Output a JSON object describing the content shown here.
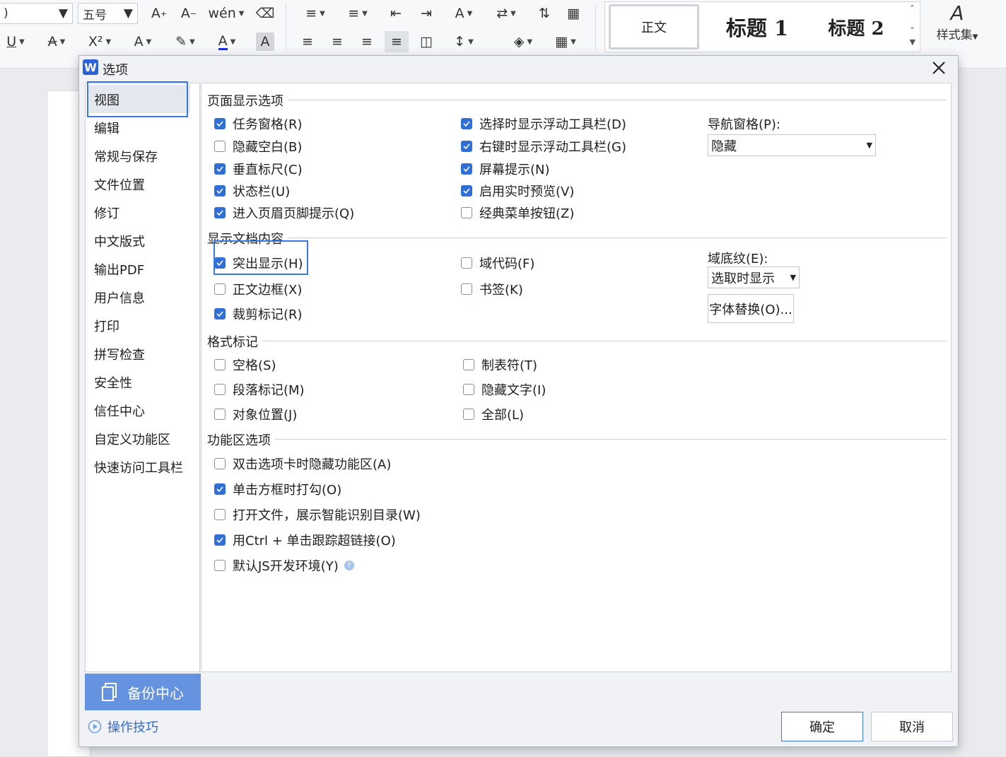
{
  "ribbon": {
    "font_name": ")",
    "font_size": "五号",
    "styles": {
      "normal": "正文",
      "heading1": "标题  1",
      "heading2": "标题  2"
    },
    "style_set_label": "样式集"
  },
  "dialog": {
    "title": "选项",
    "sidebar": {
      "items": [
        "视图",
        "编辑",
        "常规与保存",
        "文件位置",
        "修订",
        "中文版式",
        "输出PDF",
        "用户信息",
        "打印",
        "拼写检查",
        "安全性",
        "信任中心",
        "自定义功能区",
        "快速访问工具栏"
      ],
      "selected": "视图",
      "backup_label": "备份中心",
      "tips_label": "操作技巧"
    },
    "sections": {
      "page_display": "页面显示选项",
      "doc_content": "显示文档内容",
      "format_marks": "格式标记",
      "ribbon_options": "功能区选项"
    },
    "page_display": {
      "col1": [
        {
          "label": "任务窗格(R)",
          "checked": true
        },
        {
          "label": "隐藏空白(B)",
          "checked": false
        },
        {
          "label": "垂直标尺(C)",
          "checked": true
        },
        {
          "label": "状态栏(U)",
          "checked": true
        },
        {
          "label": "进入页眉页脚提示(Q)",
          "checked": true
        }
      ],
      "col2": [
        {
          "label": "选择时显示浮动工具栏(D)",
          "checked": true
        },
        {
          "label": "右键时显示浮动工具栏(G)",
          "checked": true
        },
        {
          "label": "屏幕提示(N)",
          "checked": true
        },
        {
          "label": "启用实时预览(V)",
          "checked": true
        },
        {
          "label": "经典菜单按钮(Z)",
          "checked": false
        }
      ],
      "nav_pane_label": "导航窗格(P):",
      "nav_pane_value": "隐藏"
    },
    "doc_content": {
      "col1": [
        {
          "label": "突出显示(H)",
          "checked": true
        },
        {
          "label": "正文边框(X)",
          "checked": false
        },
        {
          "label": "裁剪标记(R)",
          "checked": true
        }
      ],
      "col2": [
        {
          "label": "域代码(F)",
          "checked": false
        },
        {
          "label": "书签(K)",
          "checked": false
        }
      ],
      "field_shading_label": "域底纹(E):",
      "field_shading_value": "选取时显示",
      "font_sub_button": "字体替换(O)..."
    },
    "format_marks": {
      "col1": [
        {
          "label": "空格(S)",
          "checked": false
        },
        {
          "label": "段落标记(M)",
          "checked": false
        },
        {
          "label": "对象位置(J)",
          "checked": false
        }
      ],
      "col2": [
        {
          "label": "制表符(T)",
          "checked": false
        },
        {
          "label": "隐藏文字(I)",
          "checked": false
        },
        {
          "label": "全部(L)",
          "checked": false
        }
      ]
    },
    "ribbon_options": [
      {
        "label": "双击选项卡时隐藏功能区(A)",
        "checked": false
      },
      {
        "label": "单击方框时打勾(O)",
        "checked": true
      },
      {
        "label": "打开文件，展示智能识别目录(W)",
        "checked": false
      },
      {
        "label": "用Ctrl + 单击跟踪超链接(O)",
        "checked": true
      },
      {
        "label": "默认JS开发环境(Y)",
        "checked": false
      }
    ],
    "buttons": {
      "ok": "确定",
      "cancel": "取消"
    }
  },
  "colors": {
    "accent": "#2f6fd6",
    "backup_bg": "#6593e0",
    "highlight_border": "#3a78e2"
  }
}
